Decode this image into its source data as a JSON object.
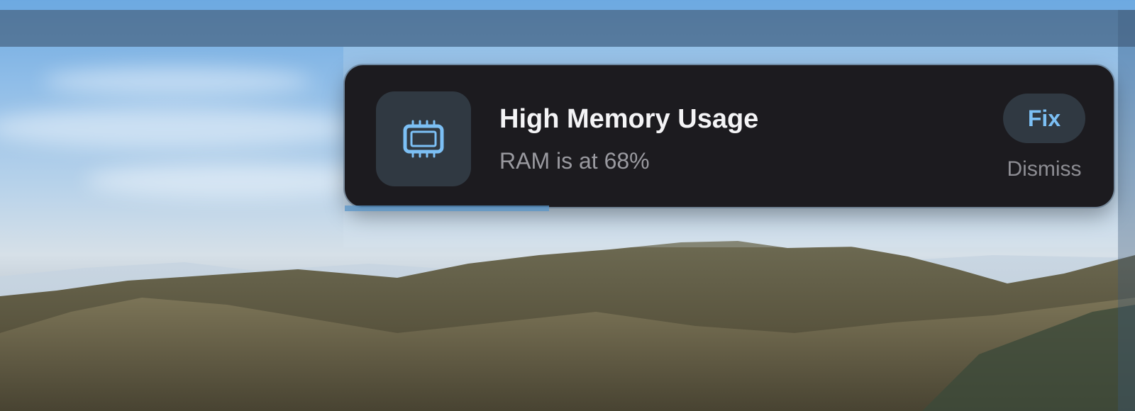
{
  "notification": {
    "icon": "memory-chip-icon",
    "title": "High Memory Usage",
    "message": "RAM is at 68%",
    "ram_percent": 68,
    "fix_label": "Fix",
    "dismiss_label": "Dismiss"
  },
  "colors": {
    "toast_background": "#1c1b1f",
    "icon_tile": "#303942",
    "accent": "#7cc0f5",
    "title_text": "#f4f4f6",
    "secondary_text": "#9a9aa0"
  },
  "wallpaper": {
    "scene": "mountain-landscape"
  }
}
